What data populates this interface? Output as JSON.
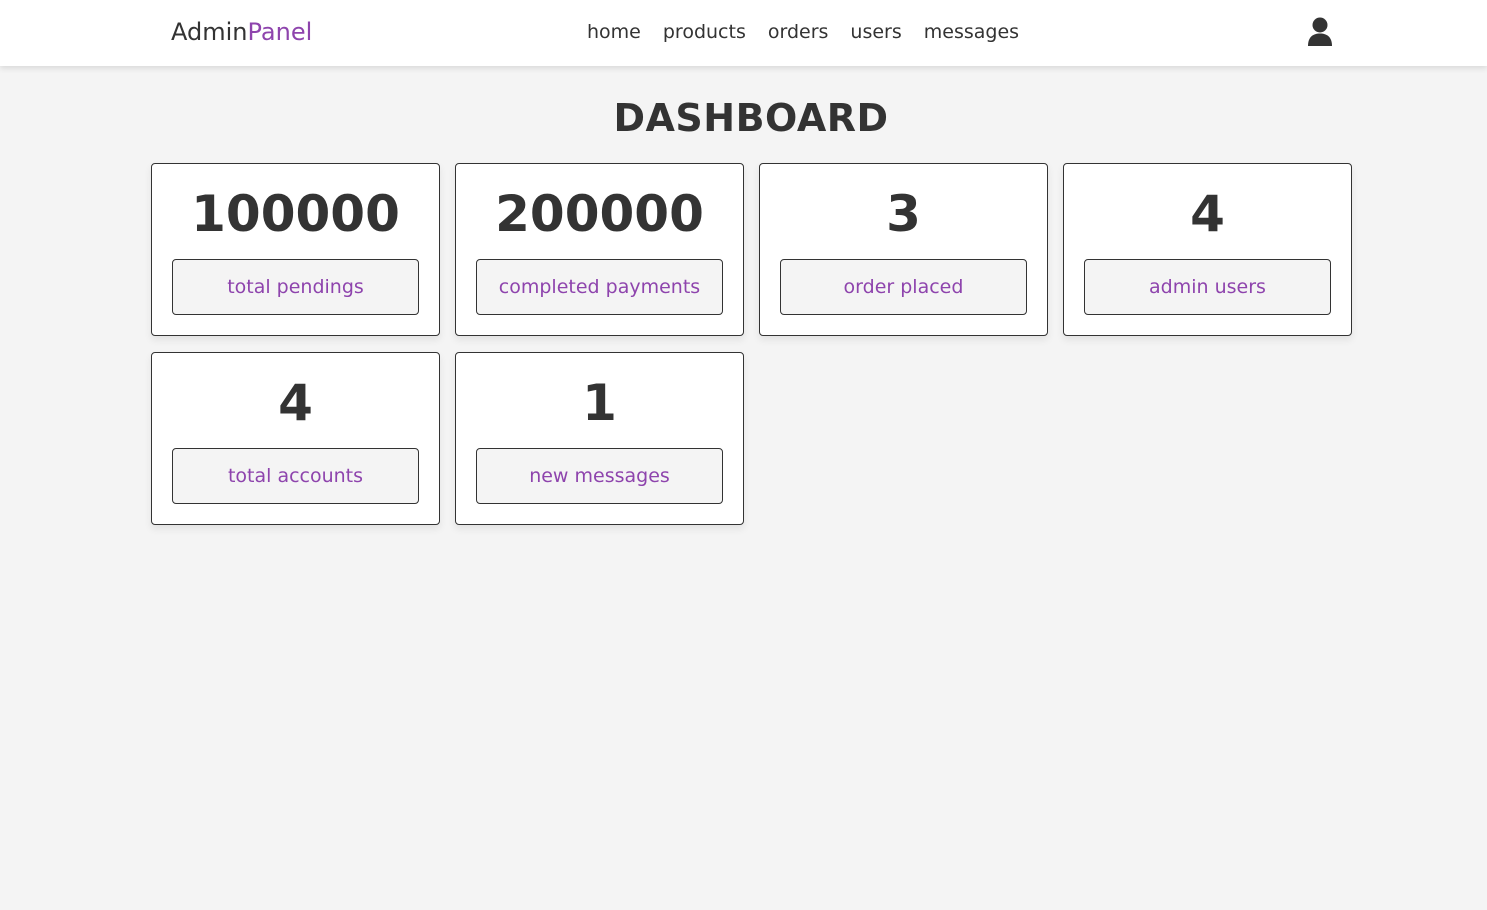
{
  "header": {
    "logo_main": "Admin",
    "logo_accent": "Panel",
    "nav": [
      "home",
      "products",
      "orders",
      "users",
      "messages"
    ],
    "user_icon": "user-icon"
  },
  "page": {
    "title": "DASHBOARD"
  },
  "cards": [
    {
      "value": "100000",
      "label": "total pendings"
    },
    {
      "value": "200000",
      "label": "completed payments"
    },
    {
      "value": "3",
      "label": "order placed"
    },
    {
      "value": "4",
      "label": "admin users"
    },
    {
      "value": "4",
      "label": "total accounts"
    },
    {
      "value": "1",
      "label": "new messages"
    }
  ],
  "colors": {
    "accent": "#8e44ad",
    "text": "#333333",
    "background": "#f4f4f4"
  }
}
